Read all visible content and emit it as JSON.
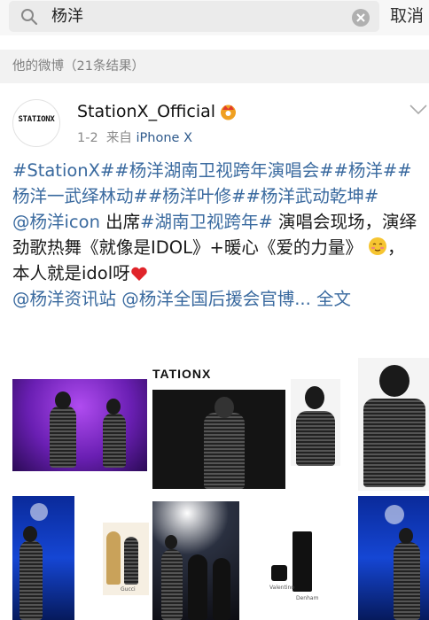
{
  "search": {
    "query": "杨洋",
    "cancel_label": "取消"
  },
  "section": {
    "title": "他的微博（21条结果）"
  },
  "post": {
    "avatar_text": "STATIONX",
    "username": "StationX_Official",
    "date": "1-2",
    "source_prefix": "来自",
    "source": "iPhone X",
    "hashtags_line": "#StationX##杨洋湖南卫视跨年演唱会##杨洋##杨洋一武绎林动##杨洋叶修##杨洋武动乾坤#",
    "mention1": "@杨洋icon",
    "text1": " 出席",
    "hashtag2": "#湖南卫视跨年#",
    "text2": " 演唱会现场，演绎劲歌热舞《就像是IDOL》+暖心《爱的力量》",
    "text3": "，本人就是idol呀",
    "mention2": "@杨洋资讯站",
    "mention3": "@杨洋全国后援会官博",
    "ellipsis": "...",
    "full_text": "全文",
    "photo_logo": "TATIONX",
    "photo_labels": {
      "gucci": "Gucci",
      "valentino": "Valentino",
      "denham": "Denham"
    }
  },
  "colors": {
    "link": "#3a6a9f",
    "background": "#f2f2f2"
  }
}
